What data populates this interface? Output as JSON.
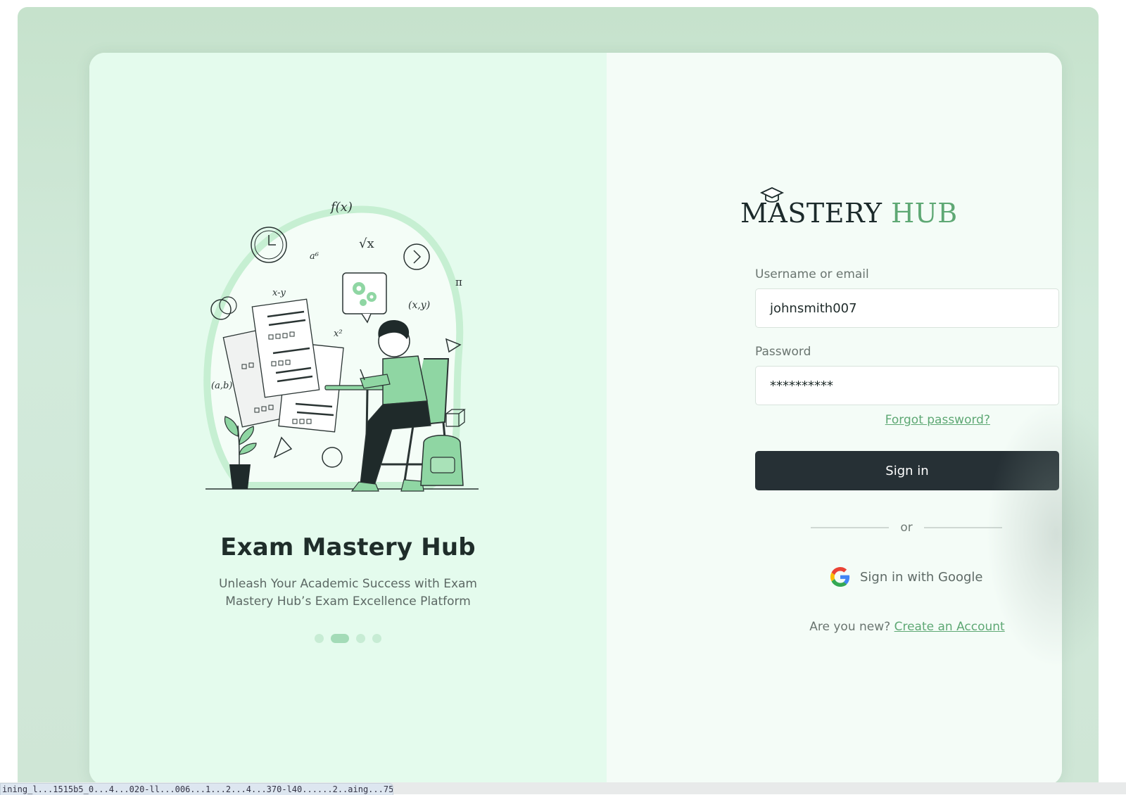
{
  "brand": {
    "logo_part1": "MASTERY",
    "logo_part2": "HUB",
    "accent_color": "#5ea874",
    "dark_color": "#263035"
  },
  "hero": {
    "title": "Exam Mastery Hub",
    "subtitle": "Unleash Your Academic Success with Exam Mastery Hub’s Exam Excellence Platform",
    "carousel": {
      "count": 4,
      "active_index": 1
    }
  },
  "form": {
    "username_label": "Username or email",
    "username_value": "johnsmith007",
    "password_label": "Password",
    "password_value": "**********",
    "forgot_label": "Forgot password?",
    "signin_label": "Sign in",
    "or_label": "or",
    "google_label": "Sign in with Google",
    "new_prompt": "Are you new?",
    "create_label": "Create an Account"
  },
  "status_bar": {
    "url_text": "ining_l...1515b5_0...4...020-ll...006...1...2...4...370-l40......2..aing...752"
  }
}
